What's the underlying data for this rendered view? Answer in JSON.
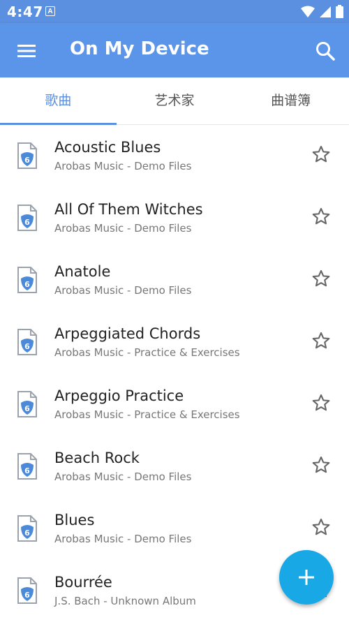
{
  "status": {
    "time": "4:47",
    "notif_letter": "A"
  },
  "header": {
    "title": "On My Device"
  },
  "tabs": [
    {
      "label": "歌曲"
    },
    {
      "label": "艺术家"
    },
    {
      "label": "曲谱簿"
    }
  ],
  "songs": [
    {
      "title": "Acoustic Blues",
      "subtitle": "Arobas Music - Demo Files"
    },
    {
      "title": "All Of Them Witches",
      "subtitle": "Arobas Music - Demo Files"
    },
    {
      "title": "Anatole",
      "subtitle": "Arobas Music - Demo Files"
    },
    {
      "title": "Arpeggiated Chords",
      "subtitle": "Arobas Music - Practice & Exercises"
    },
    {
      "title": "Arpeggio Practice",
      "subtitle": "Arobas Music - Practice & Exercises"
    },
    {
      "title": "Beach Rock",
      "subtitle": "Arobas Music - Demo Files"
    },
    {
      "title": "Blues",
      "subtitle": "Arobas Music - Demo Files"
    },
    {
      "title": "Bourrée",
      "subtitle": "J.S. Bach - Unknown Album"
    }
  ],
  "icons": {
    "menu": "menu-icon",
    "search": "search-icon",
    "file": "guitar-file-icon",
    "star": "star-outline-icon",
    "fab": "plus-icon"
  },
  "colors": {
    "app_bar": "#5b95e9",
    "accent": "#5b8fe0",
    "fab": "#18a8e6"
  }
}
